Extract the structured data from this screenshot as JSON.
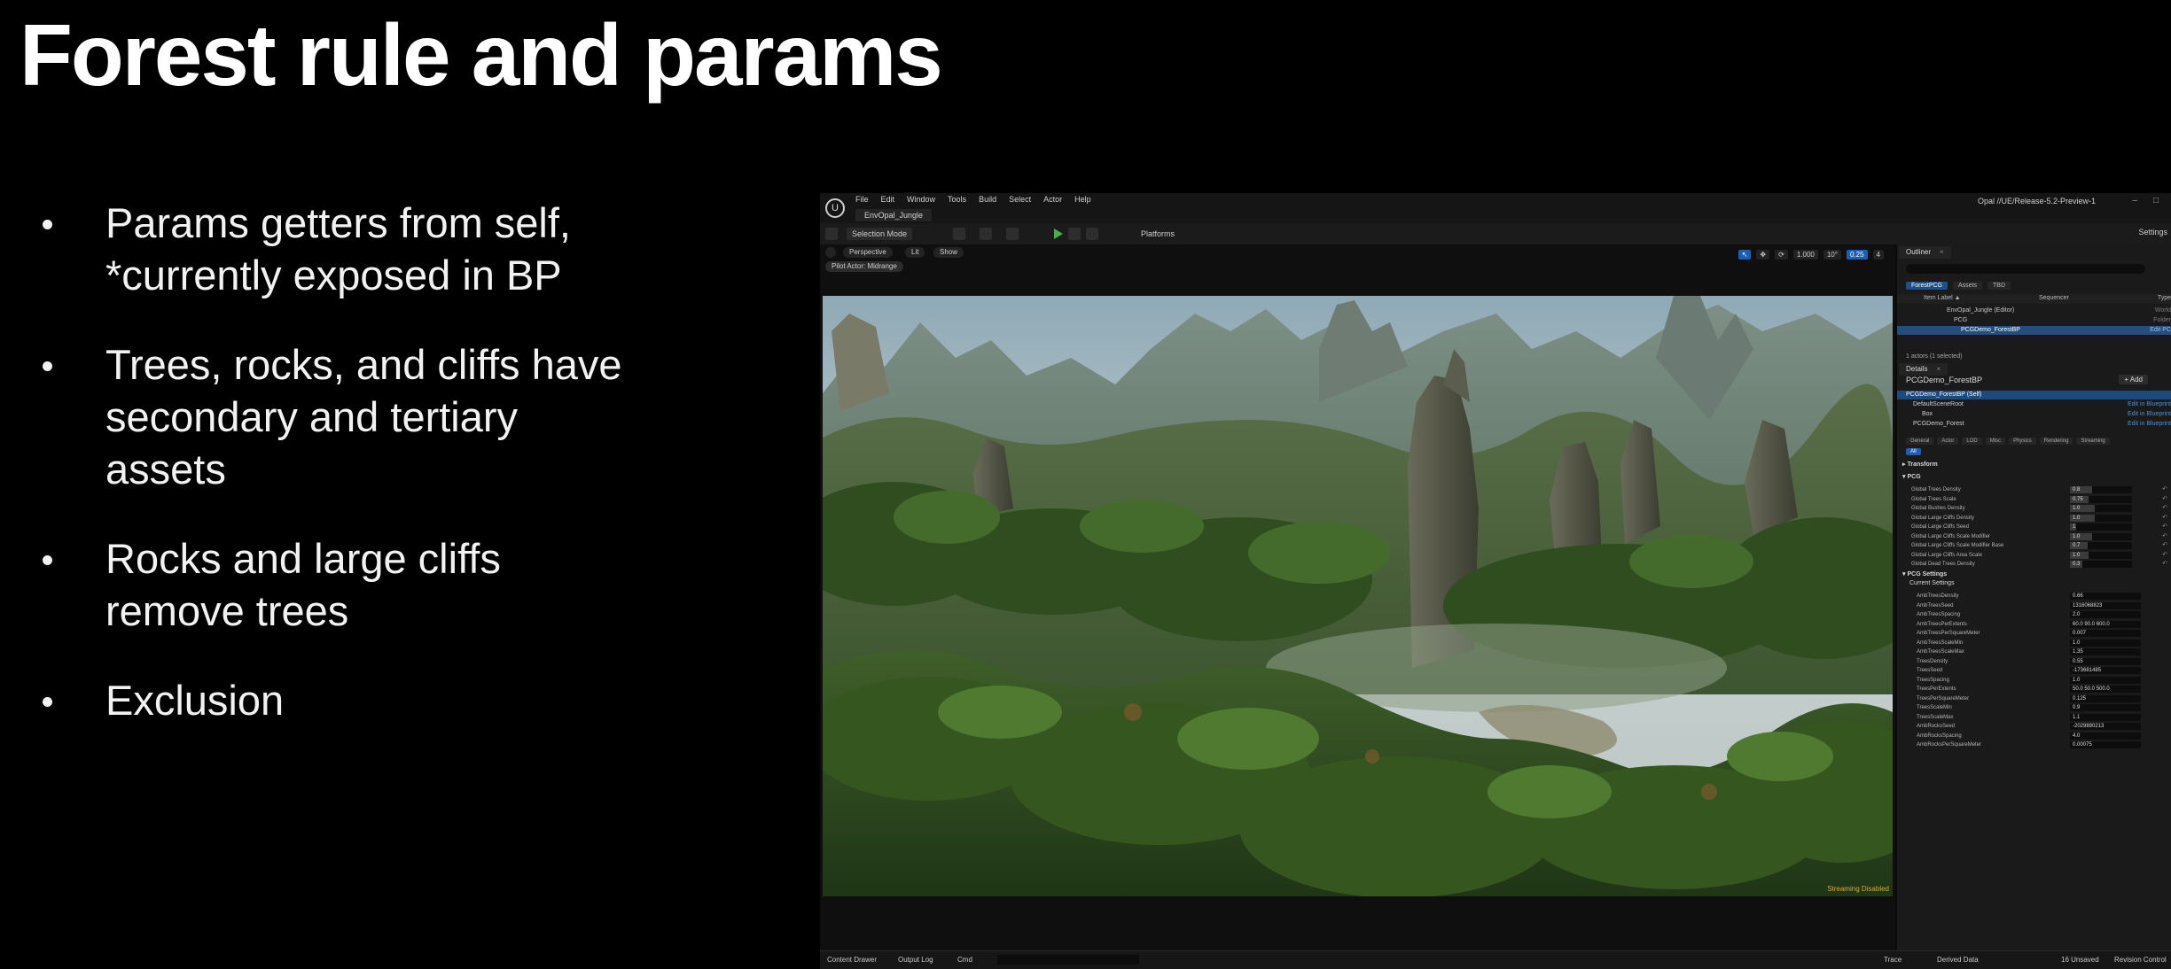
{
  "slide": {
    "title": "Forest rule and params",
    "bullets": [
      {
        "line1": "Params getters from self,",
        "line2": "*currently exposed in BP",
        "line3": ""
      },
      {
        "line1": "Trees, rocks, and cliffs have",
        "line2": "secondary and tertiary",
        "line3": "assets"
      },
      {
        "line1": "Rocks and large cliffs",
        "line2": "remove trees",
        "line3": ""
      },
      {
        "line1": "Exclusion",
        "line2": "",
        "line3": ""
      }
    ]
  },
  "editor": {
    "menu": [
      "File",
      "Edit",
      "Window",
      "Tools",
      "Build",
      "Select",
      "Actor",
      "Help"
    ],
    "level_tab": "EnvOpal_Jungle",
    "project": "Opal //UE/Release-5.2-Preview-1",
    "window_buttons": {
      "minimize": "–",
      "maximize": "□"
    },
    "toolbar": {
      "mode": "Selection Mode",
      "platforms": "Platforms",
      "settings": "Settings"
    },
    "viewport": {
      "perspective": "Perspective",
      "lit": "Lit",
      "show": "Show",
      "pilot": "Pilot Actor: Midrange",
      "snap_values": [
        "1.000",
        "10°",
        "0.25"
      ],
      "camera_speed": "4",
      "streaming_warning": "Streaming Disabled"
    },
    "statusbar": {
      "content_drawer": "Content Drawer",
      "output_log": "Output Log",
      "cmd": "Cmd",
      "trace": "Trace",
      "derived_data": "Derived Data",
      "unsaved": "16 Unsaved",
      "revision": "Revision Control"
    },
    "outliner": {
      "tab": "Outliner",
      "filter_tabs": [
        "ForestPCG",
        "Assets",
        "TBD"
      ],
      "columns": {
        "label": "Item Label ▲",
        "sequencer": "Sequencer",
        "type": "Type"
      },
      "rows": [
        {
          "label": "EnvOpal_Jungle (Editor)",
          "type": "World",
          "selected": false
        },
        {
          "label": "PCG",
          "type": "Folder",
          "selected": false
        },
        {
          "label": "PCGDemo_ForestBP",
          "type": "Edit PC",
          "selected": true
        }
      ],
      "count": "1 actors (1 selected)"
    },
    "details": {
      "tab": "Details",
      "actor": "PCGDemo_ForestBP",
      "add_button": "+ Add",
      "components": [
        {
          "label": "PCGDemo_ForestBP (Self)",
          "edit": "",
          "selected": true
        },
        {
          "label": "DefaultSceneRoot",
          "edit": "Edit in Blueprint",
          "selected": false
        },
        {
          "label": "Box",
          "edit": "Edit in Blueprint",
          "selected": false
        },
        {
          "label": "PCGDemo_Forest",
          "edit": "Edit in Blueprint",
          "selected": false
        }
      ],
      "filter_tabs": [
        "General",
        "Actor",
        "LOD",
        "Misc",
        "Physics",
        "Rendering",
        "Streaming"
      ],
      "all_chip": "All",
      "categories": {
        "transform": "Transform",
        "pcg": "PCG",
        "pcg_settings": "PCG Settings",
        "current": "Current Settings"
      },
      "pcg_props": [
        {
          "name": "Global Trees Density",
          "value": "0.8",
          "fill": 0.35
        },
        {
          "name": "Global Trees Scale",
          "value": "0.75",
          "fill": 0.3
        },
        {
          "name": "Global Bushes Density",
          "value": "1.0",
          "fill": 0.4
        },
        {
          "name": "Global Large Cliffs Density",
          "value": "1.0",
          "fill": 0.4
        },
        {
          "name": "Global Large Cliffs Seed",
          "value": "1",
          "fill": 0.1
        },
        {
          "name": "Global Large Cliffs Scale Modifier",
          "value": "1.0",
          "fill": 0.35
        },
        {
          "name": "Global Large Cliffs Scale Modifier Base",
          "value": "0.7",
          "fill": 0.28
        },
        {
          "name": "Global Large Cliffs Area Scale",
          "value": "1.0",
          "fill": 0.3
        },
        {
          "name": "Global Dead Trees Density",
          "value": "0.3",
          "fill": 0.2
        }
      ],
      "settings_props": [
        {
          "name": "AmbTreesDensity",
          "value": "0.66"
        },
        {
          "name": "AmbTreesSeed",
          "value": "1316068823"
        },
        {
          "name": "AmbTreesSpacing",
          "value": "2.0"
        },
        {
          "name": "AmbTreesPerExtents",
          "value": "60.0   90.0   600.0"
        },
        {
          "name": "AmbTreesPerSquareMeter",
          "value": "0.007"
        },
        {
          "name": "AmbTreesScaleMin",
          "value": "1.0"
        },
        {
          "name": "AmbTreesScaleMax",
          "value": "1.35"
        },
        {
          "name": "TreesDensity",
          "value": "0.55"
        },
        {
          "name": "TreesSeed",
          "value": "-173681485"
        },
        {
          "name": "TreesSpacing",
          "value": "1.0"
        },
        {
          "name": "TreesPerExtents",
          "value": "50.0   50.0   500.0"
        },
        {
          "name": "TreesPerSquareMeter",
          "value": "0.125"
        },
        {
          "name": "TreesScaleMin",
          "value": "0.9"
        },
        {
          "name": "TreesScaleMax",
          "value": "1.1"
        },
        {
          "name": "AmbRocksSeed",
          "value": "-2029890213"
        },
        {
          "name": "AmbRocksSpacing",
          "value": "4.0"
        },
        {
          "name": "AmbRocksPerSquareMeter",
          "value": "0.00075"
        }
      ]
    }
  }
}
